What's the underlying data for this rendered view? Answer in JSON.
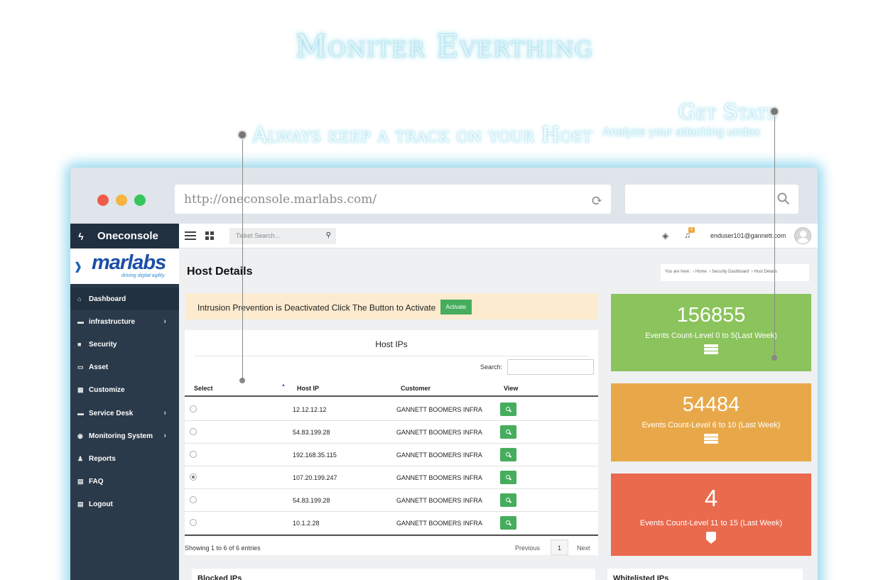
{
  "marketing": {
    "hero": "Moniter Everthing",
    "host_caption": "Always keep a track on your Host",
    "stats_caption": "Get Stats",
    "stats_subcaption": "Analyze your attacking undex"
  },
  "browser": {
    "url": "http://oneconsole.marlabs.com/",
    "search_value": ""
  },
  "app": {
    "brand": "Oneconsole",
    "logo_text": "marlabs",
    "logo_tagline": "driving digital agility",
    "sidebar": {
      "items": [
        {
          "label": "Dashboard",
          "icon": "home-icon"
        },
        {
          "label": "infrastructure",
          "icon": "briefcase-icon",
          "submenu": true
        },
        {
          "label": "Security",
          "icon": "lock-icon"
        },
        {
          "label": "Asset",
          "icon": "laptop-icon"
        },
        {
          "label": "Customize",
          "icon": "grid-icon"
        },
        {
          "label": "Service Desk",
          "icon": "briefcase-icon",
          "submenu": true
        },
        {
          "label": "Monitoring System",
          "icon": "eye-icon",
          "submenu": true
        },
        {
          "label": "Reports",
          "icon": "users-icon"
        },
        {
          "label": "FAQ",
          "icon": "calendar-icon"
        },
        {
          "label": "Logout",
          "icon": "calendar-icon"
        }
      ]
    },
    "topbar": {
      "ticket_search_placeholder": "Ticket Search...",
      "notification_count": "0",
      "user_email": "enduser101@gannett.com"
    },
    "page_title": "Host Details",
    "breadcrumb": {
      "prefix": "You are here:",
      "items": [
        "Home",
        "Security Dashboard",
        "Host Details"
      ]
    },
    "alert": {
      "message": "Intrusion Prevention is Deactivated Click The Button to Activate",
      "button": "Activate"
    },
    "host_ips": {
      "title": "Host IPs",
      "search_label": "Search:",
      "columns": [
        "Select",
        "Host IP",
        "Customer",
        "View"
      ],
      "rows": [
        {
          "ip": "12.12.12.12",
          "customer": "GANNETT BOOMERS INFRA",
          "selected": false
        },
        {
          "ip": "54.83.199.28",
          "customer": "GANNETT BOOMERS INFRA",
          "selected": false
        },
        {
          "ip": "192.168.35.115",
          "customer": "GANNETT BOOMERS INFRA",
          "selected": false
        },
        {
          "ip": "107.20.199.247",
          "customer": "GANNETT BOOMERS INFRA",
          "selected": true
        },
        {
          "ip": "54.83.199.28",
          "customer": "GANNETT BOOMERS INFRA",
          "selected": false
        },
        {
          "ip": "10.1.2.28",
          "customer": "GANNETT BOOMERS INFRA",
          "selected": false
        }
      ],
      "showing": "Showing 1 to 6 of 6 entries",
      "pagination": {
        "prev": "Previous",
        "page": "1",
        "next": "Next"
      }
    },
    "bottom_cards": {
      "blocked": "Blocked IPs",
      "whitelisted": "Whitelisted IPs"
    },
    "stats": [
      {
        "value": "156855",
        "label": "Events Count-Level 0 to 5(Last Week)",
        "color": "#8bc35c",
        "icon": "server-icon"
      },
      {
        "value": "54484",
        "label": "Events Count-Level 6 to 10 (Last Week)",
        "color": "#e8a849",
        "icon": "server-icon"
      },
      {
        "value": "4",
        "label": "Events Count-Level 11 to 15 (Last Week)",
        "color": "#e96a4d",
        "icon": "shield-icon"
      }
    ]
  }
}
